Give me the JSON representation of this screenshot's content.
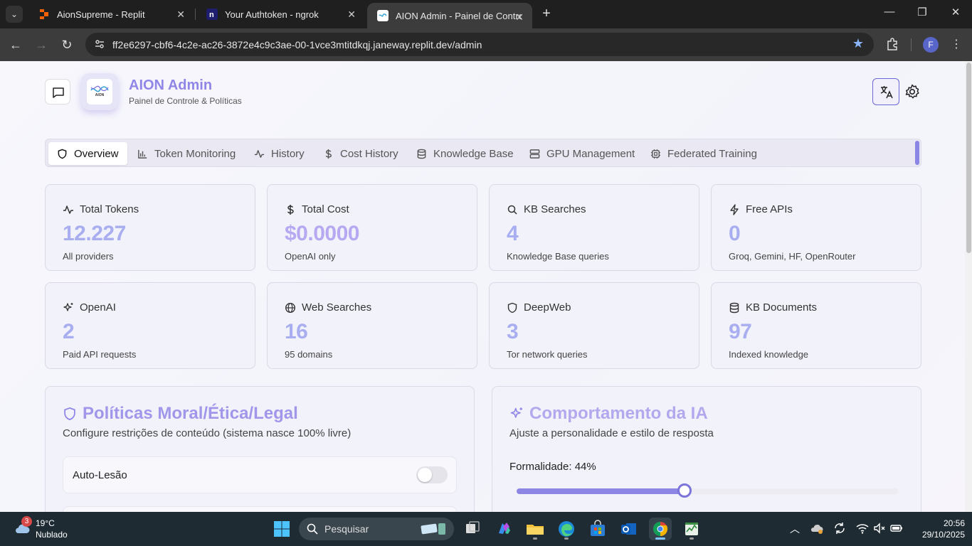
{
  "browser": {
    "tabs": [
      {
        "title": "AionSupreme - Replit",
        "active": false
      },
      {
        "title": "Your Authtoken - ngrok",
        "active": false
      },
      {
        "title": "AION Admin - Painel de Controle",
        "active": true
      }
    ],
    "url": "ff2e6297-cbf6-4c2e-ac26-3872e4c9c3ae-00-1vce3mtitdkqj.janeway.replit.dev/admin",
    "profile_initial": "F"
  },
  "header": {
    "logo_text": "AION",
    "title": "AION Admin",
    "subtitle": "Painel de Controle & Políticas"
  },
  "nav": {
    "tabs": [
      {
        "label": "Overview",
        "icon": "shield-icon",
        "active": true
      },
      {
        "label": "Token Monitoring",
        "icon": "bar-chart-icon",
        "active": false
      },
      {
        "label": "History",
        "icon": "activity-icon",
        "active": false
      },
      {
        "label": "Cost History",
        "icon": "dollar-icon",
        "active": false
      },
      {
        "label": "Knowledge Base",
        "icon": "database-icon",
        "active": false
      },
      {
        "label": "GPU Management",
        "icon": "server-icon",
        "active": false
      },
      {
        "label": "Federated Training",
        "icon": "cpu-icon",
        "active": false
      }
    ]
  },
  "stats": [
    {
      "label": "Total Tokens",
      "value": "12.227",
      "sub": "All providers",
      "icon": "activity-icon"
    },
    {
      "label": "Total Cost",
      "value": "$0.0000",
      "sub": "OpenAI only",
      "icon": "dollar-icon"
    },
    {
      "label": "KB Searches",
      "value": "4",
      "sub": "Knowledge Base queries",
      "icon": "search-icon"
    },
    {
      "label": "Free APIs",
      "value": "0",
      "sub": "Groq, Gemini, HF, OpenRouter",
      "icon": "zap-icon"
    },
    {
      "label": "OpenAI",
      "value": "2",
      "sub": "Paid API requests",
      "icon": "sparkles-icon"
    },
    {
      "label": "Web Searches",
      "value": "16",
      "sub": "95 domains",
      "icon": "globe-icon"
    },
    {
      "label": "DeepWeb",
      "value": "3",
      "sub": "Tor network queries",
      "icon": "shield-icon"
    },
    {
      "label": "KB Documents",
      "value": "97",
      "sub": "Indexed knowledge",
      "icon": "database-icon"
    }
  ],
  "policies": {
    "title": "Políticas Moral/Ética/Legal",
    "subtitle": "Configure restrições de conteúdo (sistema nasce 100% livre)",
    "items": [
      {
        "label": "Auto-Lesão",
        "enabled": false
      }
    ]
  },
  "behavior": {
    "title": "Comportamento da IA",
    "subtitle": "Ajuste a personalidade e estilo de resposta",
    "formality_label": "Formalidade: 44%",
    "formality_value": 0.44
  },
  "taskbar": {
    "weather_badge": "3",
    "temperature": "19°C",
    "weather": "Nublado",
    "search_placeholder": "Pesquisar",
    "time": "20:56",
    "date": "29/10/2025"
  },
  "colors": {
    "accent": "#8f86e8",
    "slider": "#7b74da"
  }
}
